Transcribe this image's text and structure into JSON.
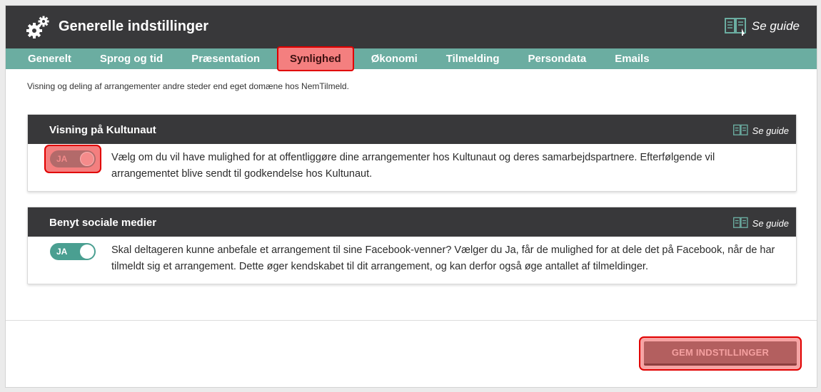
{
  "header": {
    "title": "Generelle indstillinger",
    "guide_label": "Se guide"
  },
  "tabs": [
    {
      "label": "Generelt",
      "active": false
    },
    {
      "label": "Sprog og tid",
      "active": false
    },
    {
      "label": "Præsentation",
      "active": false
    },
    {
      "label": "Synlighed",
      "active": true
    },
    {
      "label": "Økonomi",
      "active": false
    },
    {
      "label": "Tilmelding",
      "active": false
    },
    {
      "label": "Persondata",
      "active": false
    },
    {
      "label": "Emails",
      "active": false
    }
  ],
  "intro": "Visning og deling af arrangementer andre steder end eget domæne hos NemTilmeld.",
  "cards": [
    {
      "title": "Visning på Kultunaut",
      "guide_label": "Se guide",
      "toggle_label": "JA",
      "description": "Vælg om du vil have mulighed for at offentliggøre dine arrangementer hos Kultunaut og deres samarbejdspartnere. Efterfølgende vil arrangementet blive sendt til godkendelse hos Kultunaut."
    },
    {
      "title": "Benyt sociale medier",
      "guide_label": "Se guide",
      "toggle_label": "JA",
      "description": "Skal deltageren kunne anbefale et arrangement til sine Facebook-venner? Vælger du Ja, får de mulighed for at dele det på Facebook, når de har tilmeldt sig et arrangement. Dette øger kendskabet til dit arrangement, og kan derfor også øge antallet af tilmeldinger."
    }
  ],
  "save_label": "GEM INDSTILLINGER",
  "colors": {
    "header_bg": "#38383a",
    "tab_bar": "#6bada1",
    "toggle_on": "#4a9f91",
    "highlight": "#e10000"
  },
  "icons": {
    "header": "gears-icon",
    "guide": "book-guide-icon"
  }
}
